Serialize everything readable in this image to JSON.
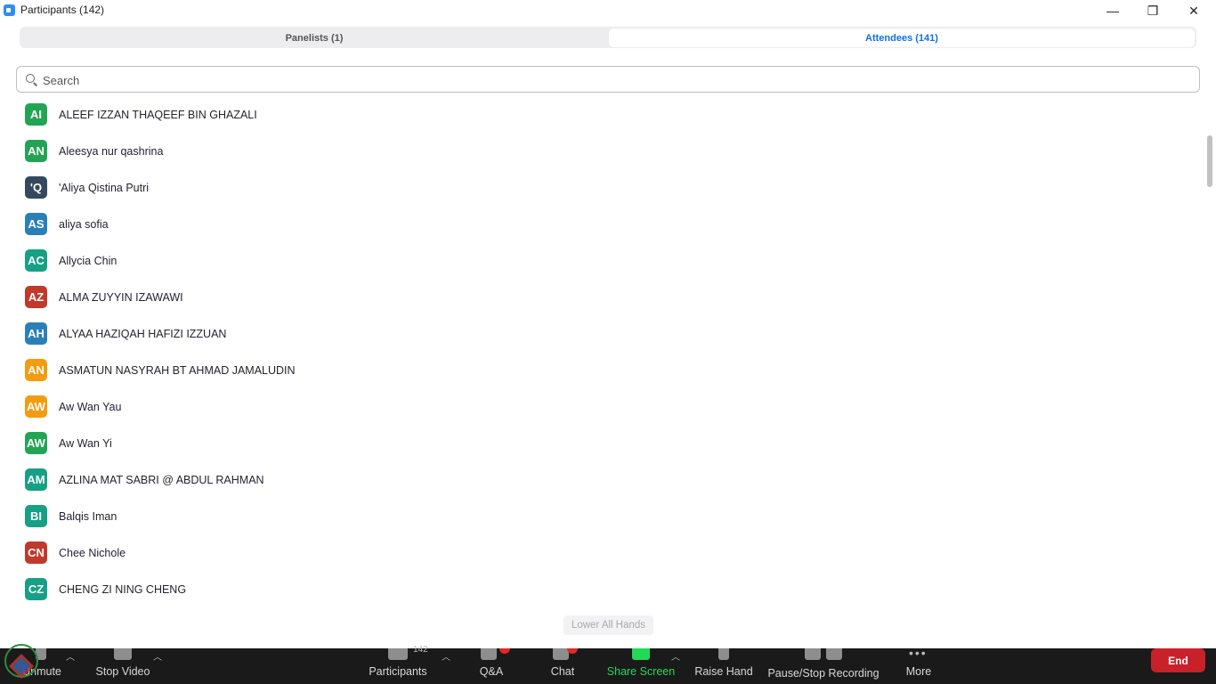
{
  "window": {
    "title": "Participants (142)",
    "minimize": "—",
    "restore": "❐",
    "close": "✕"
  },
  "tabs": [
    {
      "label": "Panelists (1)",
      "active": false
    },
    {
      "label": "Attendees (141)",
      "active": true
    }
  ],
  "search": {
    "placeholder": "Search",
    "value": ""
  },
  "participants": [
    {
      "initials": "AI",
      "name": "ALEEF IZZAN THAQEEF BIN GHAZALI",
      "color": "#23a455"
    },
    {
      "initials": "AN",
      "name": "Aleesya nur qashrina",
      "color": "#23a455"
    },
    {
      "initials": "'Q",
      "name": "'Aliya Qistina Putri",
      "color": "#34495e"
    },
    {
      "initials": "AS",
      "name": "aliya sofia",
      "color": "#2980b9"
    },
    {
      "initials": "AC",
      "name": "Allycia Chin",
      "color": "#16a085"
    },
    {
      "initials": "AZ",
      "name": "ALMA ZUYYIN IZAWAWI",
      "color": "#c0392b"
    },
    {
      "initials": "AH",
      "name": "ALYAA HAZIQAH HAFIZI IZZUAN",
      "color": "#2980b9"
    },
    {
      "initials": "AN",
      "name": "ASMATUN NASYRAH BT AHMAD JAMALUDIN",
      "color": "#f39c12"
    },
    {
      "initials": "AW",
      "name": "Aw Wan Yau",
      "color": "#f39c12"
    },
    {
      "initials": "AW",
      "name": "Aw Wan Yi",
      "color": "#23a455"
    },
    {
      "initials": "AM",
      "name": "AZLINA MAT SABRI @ ABDUL RAHMAN",
      "color": "#16a085"
    },
    {
      "initials": "BI",
      "name": "Balqis Iman",
      "color": "#16a085"
    },
    {
      "initials": "CN",
      "name": "Chee Nichole",
      "color": "#c0392b"
    },
    {
      "initials": "CZ",
      "name": "CHENG ZI NING CHENG",
      "color": "#16a085"
    }
  ],
  "lower_all_hands": "Lower All Hands",
  "toolbar": {
    "unmute": "Unmute",
    "stop_video": "Stop Video",
    "participants": "Participants",
    "participants_count": "142",
    "qa": "Q&A",
    "chat": "Chat",
    "share_screen": "Share Screen",
    "raise_hand": "Raise Hand",
    "recording": "Pause/Stop Recording",
    "more": "More",
    "end": "End"
  },
  "colors": {
    "accent": "#0e71eb",
    "share": "#23d959",
    "end": "#c9212a"
  }
}
